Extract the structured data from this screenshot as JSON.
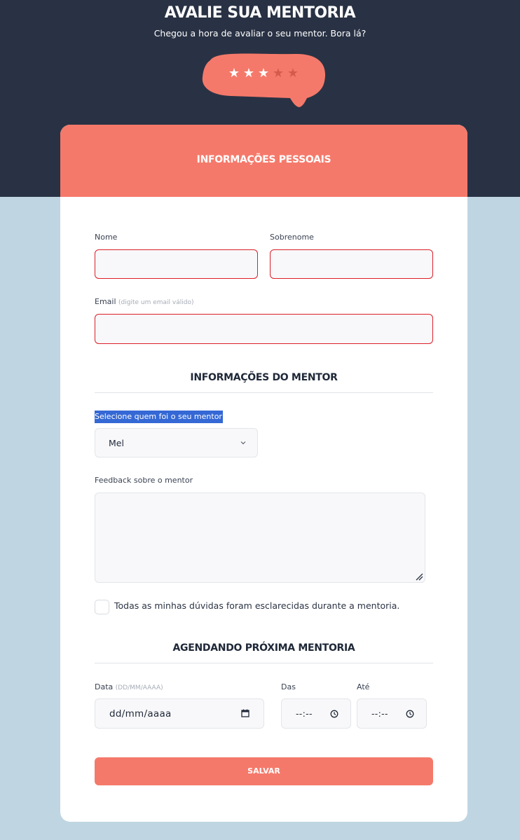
{
  "header": {
    "title": "AVALIE SUA MENTORIA",
    "subtitle": "Chegou a hora de avaliar o seu mentor. Bora lá?"
  },
  "rating": {
    "value": 3,
    "max": 5,
    "colors": {
      "bubble": "#f5796a",
      "star_on": "#ffffff",
      "star_off": "#d65a4c"
    }
  },
  "personal": {
    "section_title": "INFORMAÇÕES PESSOAIS",
    "first_name_label": "Nome",
    "first_name_value": "",
    "last_name_label": "Sobrenome",
    "last_name_value": "",
    "email_label": "Email",
    "email_hint": "(digite um email válido)",
    "email_value": ""
  },
  "mentor": {
    "section_title": "INFORMAÇÕES DO MENTOR",
    "select_label": "Selecione quem foi o seu mentor",
    "selected": "Mel",
    "feedback_label": "Feedback sobre o mentor",
    "feedback_value": "",
    "checkbox_label": "Todas as minhas dúvidas foram esclarecidas durante a mentoria.",
    "checkbox_checked": false
  },
  "schedule": {
    "section_title": "AGENDANDO PRÓXIMA MENTORIA",
    "date_label": "Data",
    "date_hint": "(DD/MM/AAAA)",
    "date_placeholder": "dd/mm/aaaa",
    "from_label": "Das",
    "from_placeholder": "--:--",
    "to_label": "Até",
    "to_placeholder": "--:--"
  },
  "actions": {
    "save_label": "SALVAR"
  },
  "colors": {
    "header_bg": "#293244",
    "page_bg": "#bfd6e2",
    "accent": "#f5796a",
    "error_border": "#dc1f28",
    "selection": "#3468d5"
  }
}
